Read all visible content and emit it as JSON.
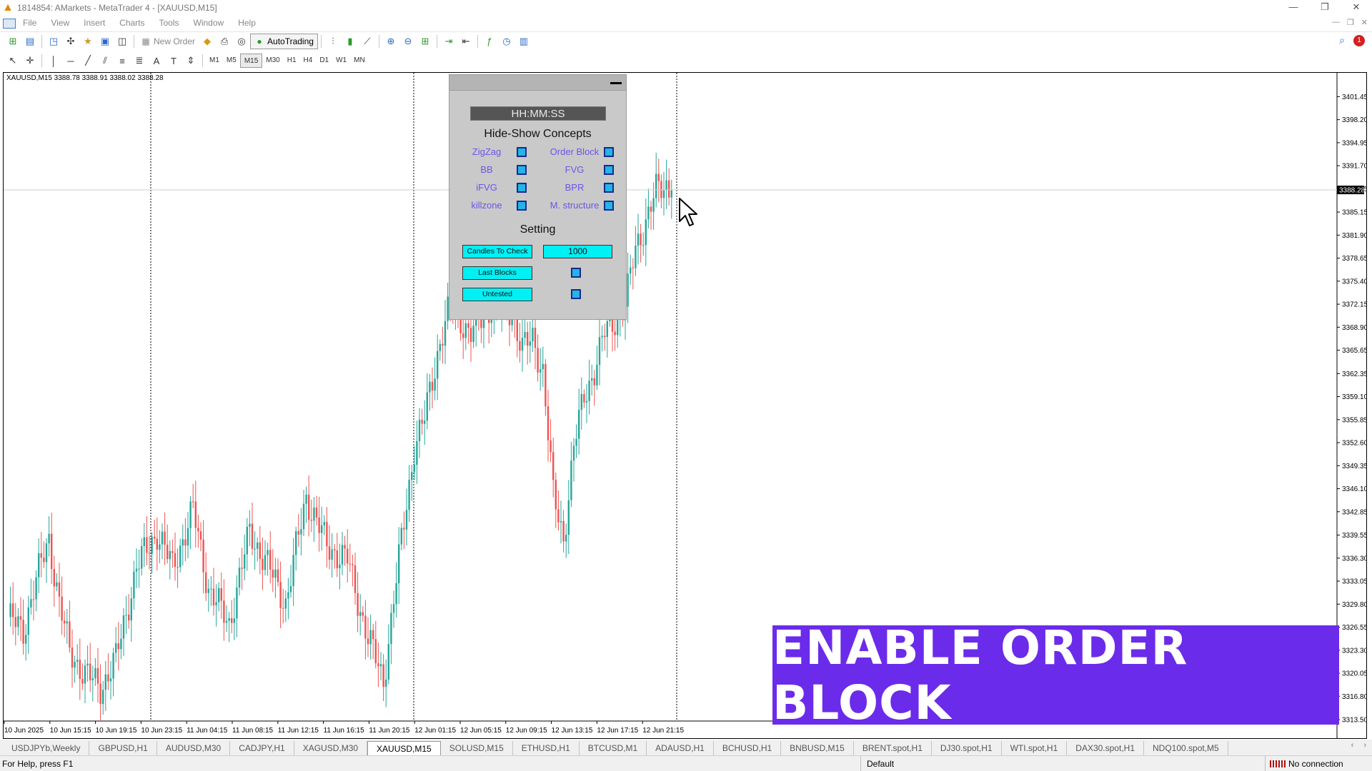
{
  "window": {
    "title": "1814854: AMarkets - MetaTrader 4 - [XAUUSD,M15]",
    "app_icon": "metatrader-icon",
    "controls": [
      "—",
      "❐",
      "✕"
    ]
  },
  "menu": {
    "items": [
      "File",
      "View",
      "Insert",
      "Charts",
      "Tools",
      "Window",
      "Help"
    ],
    "mdi_controls": [
      "—",
      "❐",
      "✕"
    ]
  },
  "toolbar": {
    "new_order_label": "New Order",
    "autotrading_label": "AutoTrading",
    "timeframes": [
      "M1",
      "M5",
      "M15",
      "M30",
      "H1",
      "H4",
      "D1",
      "W1",
      "MN"
    ],
    "active_timeframe": "M15",
    "notification_count": "1"
  },
  "chart": {
    "info": "XAUUSD,M15  3388.78 3388.91 3388.02 3388.28",
    "current_price": "3388.28"
  },
  "chart_data": {
    "type": "candlestick",
    "symbol": "XAUUSD",
    "timeframe": "M15",
    "ylim": [
      3313.5,
      3403.0
    ],
    "y_ticks": [
      "3401.45",
      "3398.20",
      "3394.95",
      "3391.70",
      "3388.45",
      "3385.15",
      "3381.90",
      "3378.65",
      "3375.40",
      "3372.15",
      "3368.90",
      "3365.65",
      "3362.35",
      "3359.10",
      "3355.85",
      "3352.60",
      "3349.35",
      "3346.10",
      "3342.85",
      "3339.55",
      "3336.30",
      "3333.05",
      "3329.80",
      "3326.55",
      "3323.30",
      "3320.05",
      "3316.80",
      "3313.50"
    ],
    "x_ticks": [
      "10 Jun 2025",
      "10 Jun 15:15",
      "10 Jun 19:15",
      "10 Jun 23:15",
      "11 Jun 04:15",
      "11 Jun 08:15",
      "11 Jun 12:15",
      "11 Jun 16:15",
      "11 Jun 20:15",
      "12 Jun 01:15",
      "12 Jun 05:15",
      "12 Jun 09:15",
      "12 Jun 13:15",
      "12 Jun 17:15",
      "12 Jun 21:15"
    ],
    "bull_color": "#26a69a",
    "bear_color": "#ef5350",
    "price_line": 3388.28,
    "anchors": [
      [
        0,
        3328
      ],
      [
        6,
        3326
      ],
      [
        10,
        3332
      ],
      [
        16,
        3339
      ],
      [
        20,
        3330
      ],
      [
        24,
        3323
      ],
      [
        30,
        3320
      ],
      [
        36,
        3318
      ],
      [
        42,
        3322
      ],
      [
        50,
        3335
      ],
      [
        58,
        3340
      ],
      [
        64,
        3335
      ],
      [
        72,
        3343
      ],
      [
        78,
        3332
      ],
      [
        86,
        3327
      ],
      [
        94,
        3340
      ],
      [
        100,
        3336
      ],
      [
        108,
        3330
      ],
      [
        116,
        3345
      ],
      [
        124,
        3338
      ],
      [
        132,
        3336
      ],
      [
        140,
        3325
      ],
      [
        146,
        3319
      ],
      [
        152,
        3336
      ],
      [
        158,
        3352
      ],
      [
        162,
        3356
      ],
      [
        168,
        3367
      ],
      [
        172,
        3372
      ],
      [
        180,
        3368
      ],
      [
        188,
        3372
      ],
      [
        196,
        3371
      ],
      [
        200,
        3366
      ],
      [
        204,
        3367
      ],
      [
        208,
        3363
      ],
      [
        212,
        3345
      ],
      [
        216,
        3339
      ],
      [
        220,
        3352
      ],
      [
        224,
        3359
      ],
      [
        228,
        3363
      ],
      [
        232,
        3368
      ],
      [
        240,
        3372
      ],
      [
        244,
        3380
      ],
      [
        248,
        3384
      ],
      [
        252,
        3388
      ],
      [
        256,
        3389
      ],
      [
        258,
        3388.28
      ]
    ]
  },
  "panel": {
    "clock": "HH:MM:SS",
    "concepts_title": "Hide-Show Concepts",
    "concepts": [
      {
        "label": "ZigZag"
      },
      {
        "label": "Order Block"
      },
      {
        "label": "BB"
      },
      {
        "label": "FVG"
      },
      {
        "label": "iFVG"
      },
      {
        "label": "BPR"
      },
      {
        "label": "killzone"
      },
      {
        "label": "M. structure"
      }
    ],
    "setting_title": "Setting",
    "candles_btn": "Candles To Check",
    "candles_value": "1000",
    "last_blocks_btn": "Last Blocks",
    "untested_btn": "Untested"
  },
  "banner": {
    "text": "ENABLE ORDER BLOCK",
    "color": "#6b2bea"
  },
  "tabs": {
    "items": [
      "USDJPYb,Weekly",
      "GBPUSD,H1",
      "AUDUSD,M30",
      "CADJPY,H1",
      "XAGUSD,M30",
      "XAUUSD,M15",
      "SOLUSD,M15",
      "ETHUSD,H1",
      "BTCUSD,M1",
      "ADAUSD,H1",
      "BCHUSD,H1",
      "BNBUSD,M15",
      "BRENT.spot,H1",
      "DJ30.spot,H1",
      "WTI.spot,H1",
      "DAX30.spot,H1",
      "NDQ100.spot,M5"
    ],
    "active": "XAUUSD,M15"
  },
  "status": {
    "help": "For Help, press F1",
    "profile": "Default",
    "connection": "No connection"
  }
}
